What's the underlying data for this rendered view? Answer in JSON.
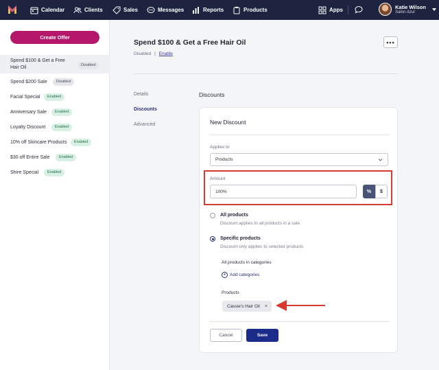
{
  "nav": {
    "items": [
      {
        "label": "Calendar",
        "icon": "calendar-icon"
      },
      {
        "label": "Clients",
        "icon": "clients-icon"
      },
      {
        "label": "Sales",
        "icon": "tag-icon"
      },
      {
        "label": "Messages",
        "icon": "chat-icon"
      },
      {
        "label": "Reports",
        "icon": "bar-chart-icon"
      },
      {
        "label": "Products",
        "icon": "products-icon"
      }
    ],
    "apps_label": "Apps",
    "user_name": "Katie Wilson",
    "user_salon": "Salon Azul"
  },
  "sidebar": {
    "create_label": "Create Offer",
    "offers": [
      {
        "label": "Spend $100 & Get a Free Hair Oil",
        "status": "Disabled"
      },
      {
        "label": "Spend $200 Sale",
        "status": "Disabled"
      },
      {
        "label": "Facial Special",
        "status": "Enabled"
      },
      {
        "label": "Anniversary Sale",
        "status": "Enabled"
      },
      {
        "label": "Loyalty Discount",
        "status": "Enabled"
      },
      {
        "label": "10% off Skincare Products",
        "status": "Enabled"
      },
      {
        "label": "$30 off Entire Sale",
        "status": "Enabled"
      },
      {
        "label": "Shire Special",
        "status": "Enabled"
      }
    ]
  },
  "main": {
    "title": "Spend $100 & Get a Free Hair Oil",
    "status": "Disabled",
    "status_sep": "|",
    "enable_link": "Enable",
    "more_label": "•••",
    "tabs": [
      "Details",
      "Discounts",
      "Advanced"
    ],
    "section_title": "Discounts"
  },
  "discount": {
    "card_title": "New Discount",
    "applies_to_label": "Applies to",
    "applies_to_value": "Products",
    "amount_label": "Amount",
    "amount_value": "100%",
    "percent_label": "%",
    "dollar_label": "$",
    "all_products_title": "All products",
    "all_products_desc": "Discount applies to all products in a sale",
    "specific_title": "Specific products",
    "specific_desc": "Discount only applies to selected products",
    "categories_label": "All products in categories",
    "add_categories": "Add categories",
    "products_label": "Products",
    "product_chip": "Cassie's Hair Oil",
    "cancel_label": "Cancel",
    "save_label": "Save"
  },
  "colors": {
    "nav_bg": "#1e2440",
    "accent_magenta": "#b5176b",
    "primary_blue": "#1b2b8a",
    "annotation_red": "#d93a2f"
  }
}
